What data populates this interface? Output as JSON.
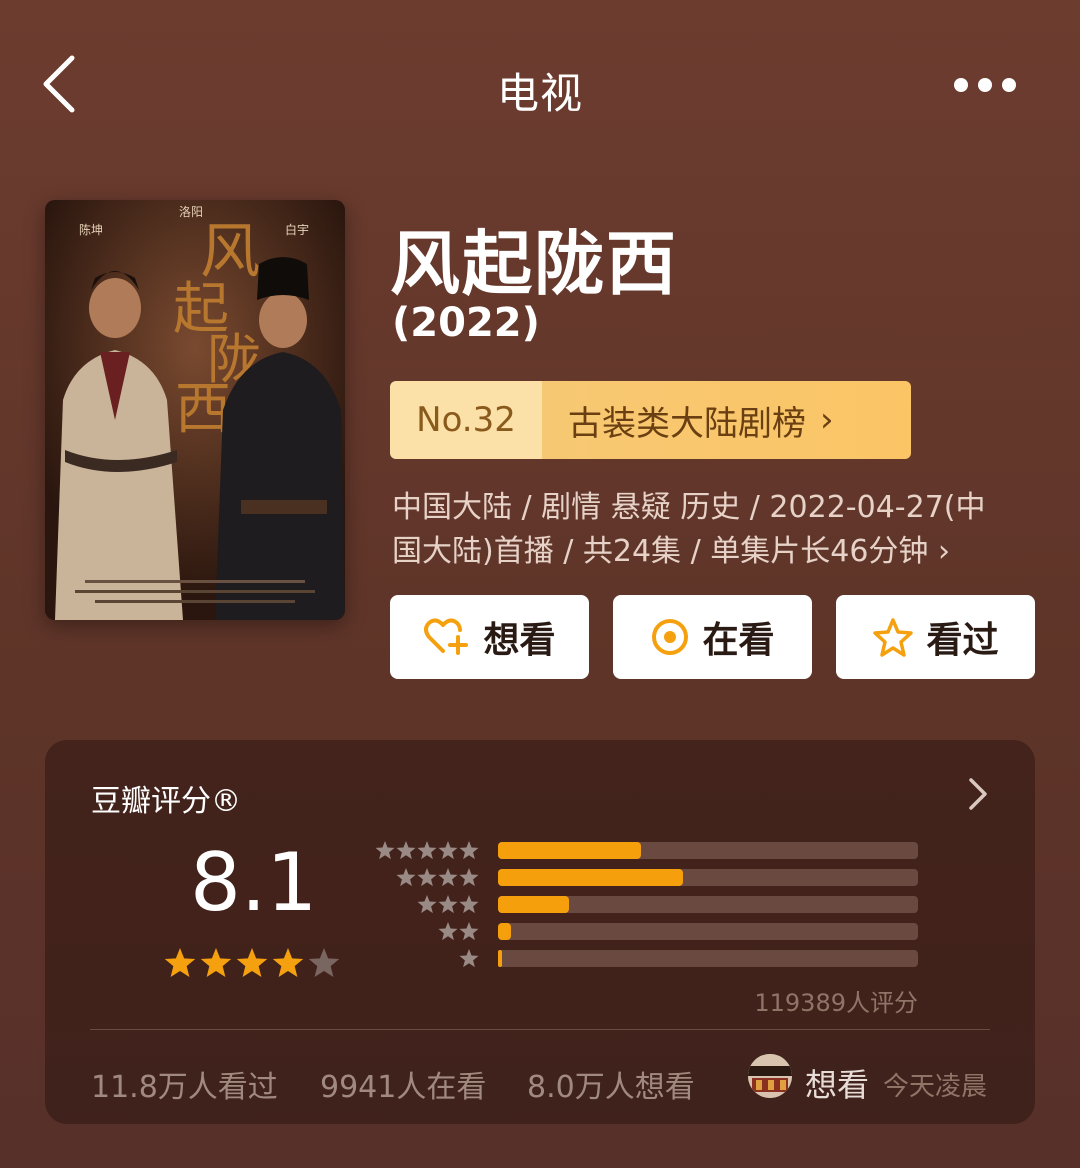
{
  "header": {
    "title": "电视",
    "back_icon": "chevron-left-icon",
    "more_icon": "ellipsis-icon"
  },
  "poster": {
    "title_chars": [
      "风",
      "起",
      "陇",
      "西"
    ],
    "city": "洛阳",
    "actor_left": "陈坤",
    "actor_right": "白宇"
  },
  "show": {
    "name": "风起陇西",
    "year": "(2022)"
  },
  "ranking": {
    "number": "No.32",
    "label": "古装类大陆剧榜",
    "chevron": "›"
  },
  "meta": {
    "line1": "中国大陆 / 剧情 悬疑 历史 / 2022-04-27(中",
    "line2": "国大陆)首播 / 共24集 / 单集片长46分钟 ›"
  },
  "actions": [
    {
      "label": "想看",
      "icon": "heart-plus-icon"
    },
    {
      "label": "在看",
      "icon": "target-circle-icon"
    },
    {
      "label": "看过",
      "icon": "star-outline-icon"
    }
  ],
  "rating": {
    "title": "豆瓣评分®",
    "score": "8.1",
    "stars": 4,
    "distribution": [
      {
        "stars": 5,
        "fraction": 0.34
      },
      {
        "stars": 4,
        "fraction": 0.44
      },
      {
        "stars": 3,
        "fraction": 0.17
      },
      {
        "stars": 2,
        "fraction": 0.03
      },
      {
        "stars": 1,
        "fraction": 0.01
      }
    ],
    "total": "119389人评分"
  },
  "stats": {
    "watched": "11.8万人看过",
    "watching": "9941人在看",
    "want": "8.0万人想看"
  },
  "friend": {
    "action": "想看",
    "time": "今天凌晨"
  },
  "colors": {
    "accent": "#f59f0d",
    "background": "#6c3c2f",
    "rank_gold": "#f7c873"
  }
}
